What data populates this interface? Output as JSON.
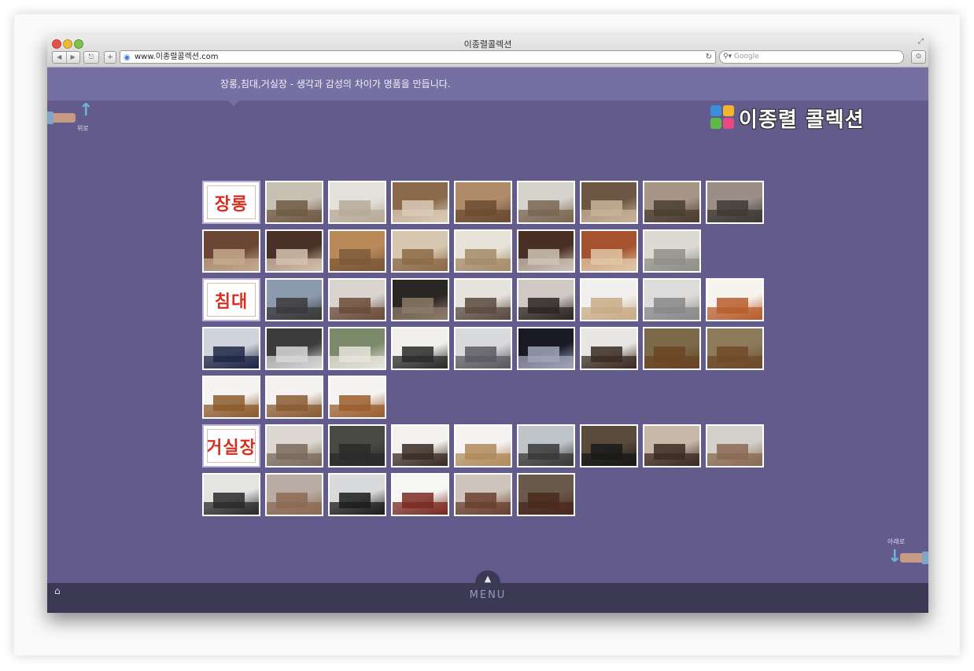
{
  "browser": {
    "window_title": "이종렬콜렉션",
    "url": "www.이종렬콜렉션.com",
    "search_placeholder": "Google",
    "back_glyph": "◀",
    "forward_glyph": "▶",
    "add_glyph": "+",
    "reload_glyph": "↻",
    "icons": [
      "close-button",
      "minimize-button",
      "zoom-button",
      "back-icon",
      "forward-icon",
      "share-icon",
      "add-tab-icon",
      "globe-icon",
      "reload-icon",
      "search-icon",
      "downloads-icon",
      "resize-icon"
    ]
  },
  "site": {
    "tagline": "장롱,침대,거실장 - 생각과 감성의 차이가 명품을 만듭니다.",
    "logo_text": "이종렬 콜렉션",
    "logo_colors": [
      "#3a8fd8",
      "#f2b531",
      "#5fb94a",
      "#e64b86"
    ],
    "up_label": "위로",
    "down_label": "아래로",
    "menu_label": "MENU",
    "home_icon": "home-icon"
  },
  "categories": [
    {
      "label": "장롱",
      "tiles": [
        [
          "#c9c0b4",
          "#6f5a45"
        ],
        [
          "#e4e1dc",
          "#b7aa98"
        ],
        [
          "#8a6a4a",
          "#d9cbb8"
        ],
        [
          "#b08b6a",
          "#6b4c33"
        ],
        [
          "#d6d2cc",
          "#7a6552"
        ],
        [
          "#6e5644",
          "#c8b39a"
        ],
        [
          "#a69585",
          "#4a3d33"
        ],
        [
          "#9a8e86",
          "#3f3a36"
        ],
        [
          "#6b4634",
          "#c4a98d"
        ],
        [
          "#4a3128",
          "#d3c2ae"
        ],
        [
          "#b98a58",
          "#7c5a3a"
        ],
        [
          "#d7c6b0",
          "#8d6b49"
        ],
        [
          "#e7e3d8",
          "#a58b68"
        ],
        [
          "#4a2f25",
          "#cfc3b7"
        ],
        [
          "#a5532e",
          "#e0c7a6"
        ],
        [
          "#dcdad2",
          "#8f8f88"
        ]
      ]
    },
    {
      "label": "침대",
      "tiles": [
        [
          "#8c9ab0",
          "#3a3a3a"
        ],
        [
          "#d9d4d0",
          "#6a4b3a"
        ],
        [
          "#2a2624",
          "#8c7a6a"
        ],
        [
          "#e6e2de",
          "#5a4a40"
        ],
        [
          "#cfc8c4",
          "#2d2523"
        ],
        [
          "#f2f0ee",
          "#c9ab86"
        ],
        [
          "#dedcda",
          "#888888"
        ],
        [
          "#f7f4f0",
          "#b85c2c"
        ],
        [
          "#cfd4dc",
          "#1f2747"
        ],
        [
          "#3c3c3c",
          "#d8d8d8"
        ],
        [
          "#7c8a6c",
          "#e8e4dc"
        ],
        [
          "#f2f0ec",
          "#2a2a2a"
        ],
        [
          "#d9dadc",
          "#5a5a60"
        ],
        [
          "#1a1a24",
          "#a0a4b8"
        ],
        [
          "#e8e6e4",
          "#3a2a22"
        ],
        [
          "#7a6a4a",
          "#6b4424"
        ],
        [
          "#8c7a5a",
          "#6e4a2a"
        ],
        [
          "#f6f4f2",
          "#8c5a2c"
        ],
        [
          "#f4f2f0",
          "#8a5a30"
        ],
        [
          "#f6f4f2",
          "#9a5e2e"
        ]
      ]
    },
    {
      "label": "거실장",
      "tiles": [
        [
          "#dcd7d0",
          "#7a6a5c"
        ],
        [
          "#4a4a44",
          "#2a2a2a"
        ],
        [
          "#f4f2f0",
          "#3a2a24"
        ],
        [
          "#f6f4f2",
          "#b08a5a"
        ],
        [
          "#bfc4c8",
          "#3a3838"
        ],
        [
          "#5a4a3c",
          "#1a1a1a"
        ],
        [
          "#c8b8a8",
          "#3c2a24"
        ],
        [
          "#d4d0cc",
          "#8a6a52"
        ],
        [
          "#e4e4e2",
          "#2a2a2a"
        ],
        [
          "#b8aca4",
          "#8c6a54"
        ],
        [
          "#d8dadc",
          "#1c1c1c"
        ],
        [
          "#f6f6f4",
          "#7a2a22"
        ],
        [
          "#cfc4bc",
          "#6a4030"
        ],
        [
          "#6a5a4c",
          "#4a2a1c"
        ]
      ]
    }
  ]
}
